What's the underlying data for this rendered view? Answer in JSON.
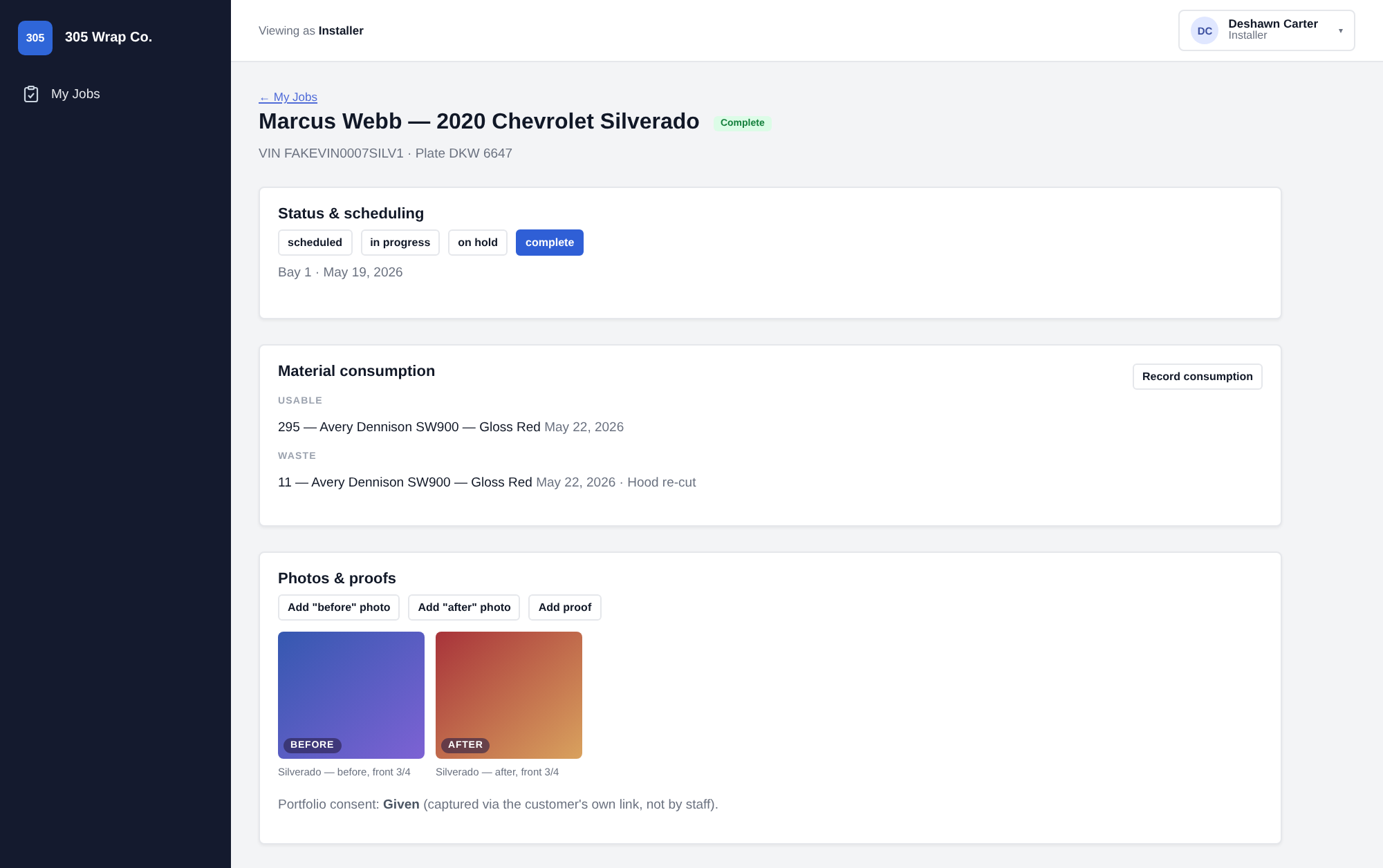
{
  "sidebar": {
    "logo": "305",
    "brand": "305 Wrap Co.",
    "items": [
      {
        "label": "My Jobs",
        "selected": true
      }
    ]
  },
  "topbar": {
    "viewing_prefix": "Viewing as",
    "viewing_role": "Installer",
    "user": {
      "initials": "DC",
      "name": "Deshawn Carter",
      "role": "Installer",
      "caret": "▾"
    }
  },
  "job": {
    "back_link": "← My Jobs",
    "title": "Marcus Webb — 2020 Chevrolet Silverado",
    "status_badge": "Complete",
    "subtitle": "VIN FAKEVIN0007SILV1 · Plate DKW 6647"
  },
  "status_card": {
    "title": "Status & scheduling",
    "statuses": [
      {
        "label": "scheduled",
        "selected": false
      },
      {
        "label": "in progress",
        "selected": false
      },
      {
        "label": "on hold",
        "selected": false
      },
      {
        "label": "complete",
        "selected": true
      }
    ],
    "schedule": "Bay 1 · May 19, 2026"
  },
  "material_card": {
    "title": "Material consumption",
    "action": "Record consumption",
    "groups": [
      {
        "heading": "USABLE",
        "entries": [
          {
            "text": "295 — Avery Dennison SW900 — Gloss Red",
            "meta": "May 22, 2026"
          }
        ]
      },
      {
        "heading": "WASTE",
        "entries": [
          {
            "text": "11 — Avery Dennison SW900 — Gloss Red",
            "meta": "May 22, 2026 · Hood re-cut"
          }
        ]
      }
    ]
  },
  "photos_card": {
    "title": "Photos & proofs",
    "buttons": [
      "Add \"before\" photo",
      "Add \"after\" photo",
      "Add proof"
    ],
    "photos": [
      {
        "kind": "before",
        "badge": "BEFORE",
        "caption": "Silverado — before, front 3/4"
      },
      {
        "kind": "after",
        "badge": "AFTER",
        "caption": "Silverado — after, front 3/4"
      }
    ],
    "consent": "Portfolio consent: **Given** (captured via the customer's own link, not by staff)."
  }
}
